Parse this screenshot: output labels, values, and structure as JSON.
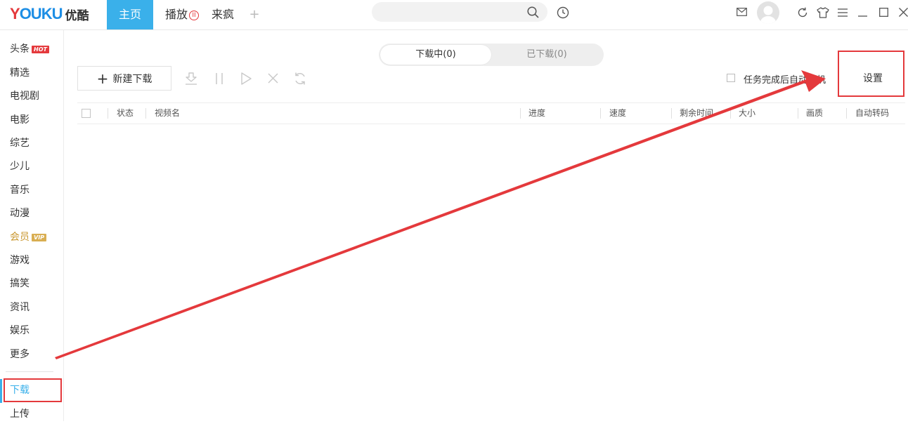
{
  "topbar": {
    "logo_brand_first": "Y",
    "logo_brand_rest": "OUKU",
    "logo_cn": "优酷",
    "nav": [
      {
        "label": "主页"
      },
      {
        "label": "播放",
        "badge": "II"
      },
      {
        "label": "来疯"
      },
      {
        "label": "+"
      }
    ],
    "search": {
      "placeholder": "",
      "value": ""
    },
    "icons": [
      "search-icon",
      "history-icon",
      "mail-icon",
      "avatar",
      "refresh-icon",
      "skin-icon",
      "menu-icon",
      "minimize-icon",
      "maximize-icon",
      "close-icon"
    ]
  },
  "sidebar": {
    "items": [
      {
        "label": "头条",
        "badge": "HOT"
      },
      {
        "label": "精选"
      },
      {
        "label": "电视剧"
      },
      {
        "label": "电影"
      },
      {
        "label": "综艺"
      },
      {
        "label": "少儿"
      },
      {
        "label": "音乐"
      },
      {
        "label": "动漫"
      },
      {
        "label": "会员",
        "badge": "VIP"
      },
      {
        "label": "游戏"
      },
      {
        "label": "搞笑"
      },
      {
        "label": "资讯"
      },
      {
        "label": "娱乐"
      },
      {
        "label": "更多"
      }
    ],
    "download": "下载",
    "upload": "上传"
  },
  "downloads": {
    "tabs": {
      "downloading": "下载中(0)",
      "downloaded": "已下载(0)"
    },
    "new_download": "新建下载",
    "toolbar_icons": [
      "download-start-icon",
      "pause-icon",
      "play-icon",
      "delete-icon",
      "retry-icon"
    ],
    "auto_shutdown": "任务完成后自动关机",
    "settings": "设置",
    "columns": [
      "状态",
      "视频名",
      "进度",
      "速度",
      "剩余时间",
      "大小",
      "画质",
      "自动转码"
    ]
  },
  "colors": {
    "accent": "#3ab0ea",
    "annotation": "#e4393c",
    "vip": "#d9ae52"
  }
}
